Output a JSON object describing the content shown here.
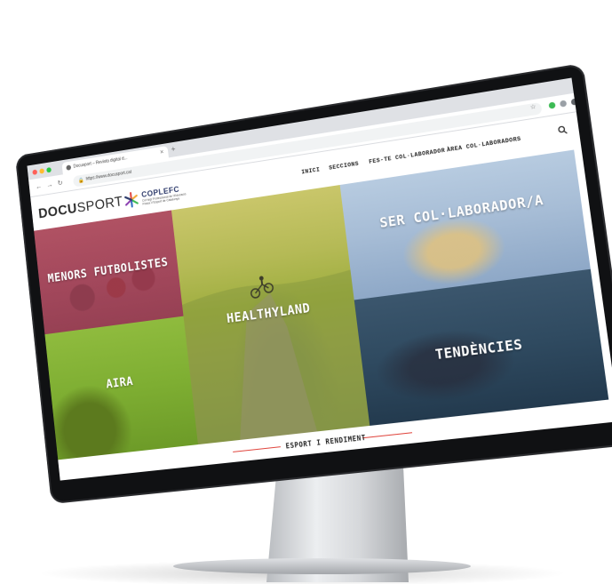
{
  "browser": {
    "tab_title": "Docusport – Revista digital d...",
    "url": "https://www.docusport.cat"
  },
  "site": {
    "logo_bold": "DOCU",
    "logo_light": "SPORT",
    "partner_name": "COPLEFC",
    "partner_sub": "Col·legi Professional de l'Educació Física i l'Esport de Catalunya"
  },
  "nav": {
    "items": [
      "INICI",
      "SECCIONS",
      "FES-TE COL·LABORADOR",
      "ÀREA COL·LABORADORS"
    ]
  },
  "tiles": {
    "menors": "MENORS FUTBOLISTES",
    "healthyland": "HEALTHYLAND",
    "aira": "AIRA",
    "ser": "SER COL·LABORADOR/A",
    "tendencies": "TENDÈNCIES"
  },
  "section": {
    "title": "ESPORT I RENDIMENT",
    "more": "[+]"
  },
  "colors": {
    "accent": "#e0463e",
    "logo_text": "#2b2b2b"
  }
}
